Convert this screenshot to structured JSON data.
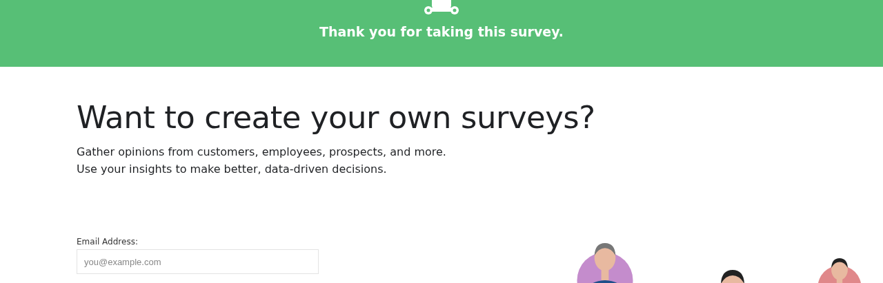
{
  "header": {
    "title": "Thank you for taking this survey."
  },
  "promo": {
    "heading": "Want to create your own surveys?",
    "lines": [
      "Gather opinions from customers, employees, prospects, and more.",
      "Use your insights to make better, data-driven decisions."
    ]
  },
  "signup": {
    "label": "Email Address:",
    "placeholder": "you@example.com"
  }
}
